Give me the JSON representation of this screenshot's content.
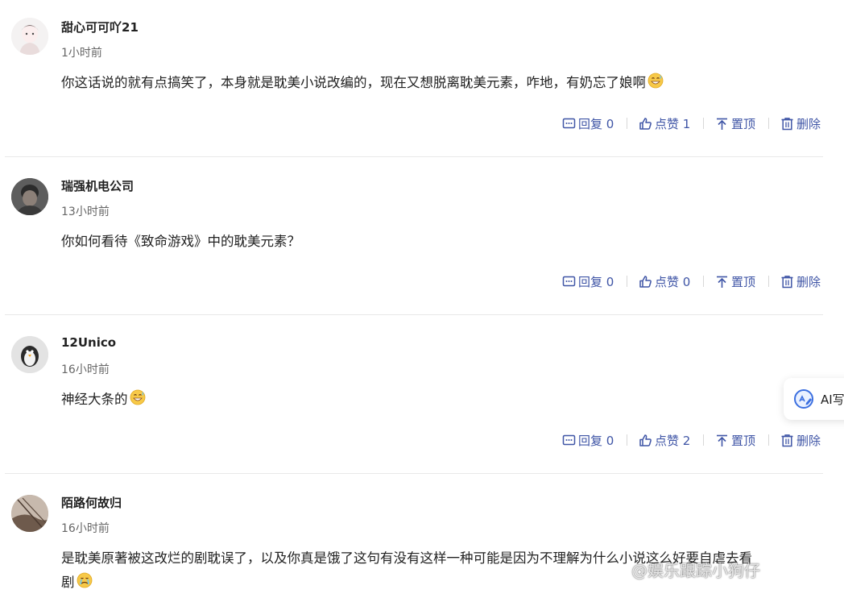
{
  "comments": [
    {
      "username": "甜心可可吖21",
      "time": "1小时前",
      "text": "你这话说的就有点搞笑了，本身就是耽美小说改编的，现在又想脱离耽美元素，咋地，有奶忘了娘啊",
      "emoji": "grinning-sweat-emoji",
      "reply_label": "回复 0",
      "like_label": "点赞 1",
      "pin_label": "置顶",
      "delete_label": "删除"
    },
    {
      "username": "瑞强机电公司",
      "time": "13小时前",
      "text": "你如何看待《致命游戏》中的耽美元素？",
      "reply_label": "回复 0",
      "like_label": "点赞 0",
      "pin_label": "置顶",
      "delete_label": "删除"
    },
    {
      "username": "12Unico",
      "time": "16小时前",
      "text": "神经大条的",
      "emoji": "grinning-sweat-emoji",
      "reply_label": "回复 0",
      "like_label": "点赞 2",
      "pin_label": "置顶",
      "delete_label": "删除"
    },
    {
      "username": "陌路何故归",
      "time": "16小时前",
      "text_line1": "是耽美原著被这改烂的剧耽误了，以及你真是饿了这句有没有这样一种可能是因为不理解为什么小说这么好要自虐去看",
      "text_line2": "剧",
      "emoji": "crying-sweat-emoji"
    }
  ],
  "ai_button": {
    "label": "AI写",
    "icon": "ai-write-icon"
  },
  "watermark": "@娱乐跟踪小狗仔",
  "colors": {
    "action": "#3f55a6",
    "divider": "#e8e8e8",
    "username": "#222222",
    "time": "#666666"
  }
}
